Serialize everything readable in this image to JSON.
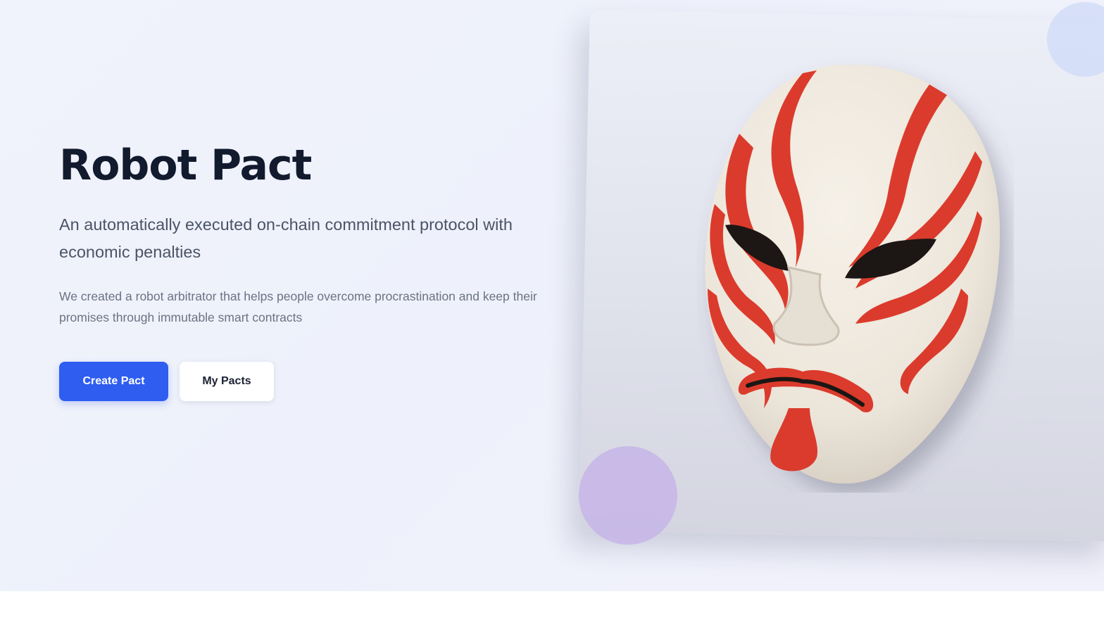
{
  "hero": {
    "title": "Robot Pact",
    "subtitle": "An automatically executed on-chain commitment protocol with economic penalties",
    "description": "We created a robot arbitrator that helps people overcome procrastination and keep their promises through immutable smart contracts",
    "primary_button": "Create Pact",
    "secondary_button": "My Pacts"
  },
  "illustration": {
    "icon": "kabuki-mask-icon"
  },
  "colors": {
    "accent": "#2f5df0",
    "title": "#121a2e",
    "mask_red": "#db3b2c",
    "mask_white": "#efe9e0",
    "blob_blue": "#d5def8",
    "blob_purple": "#c4b0e8"
  }
}
